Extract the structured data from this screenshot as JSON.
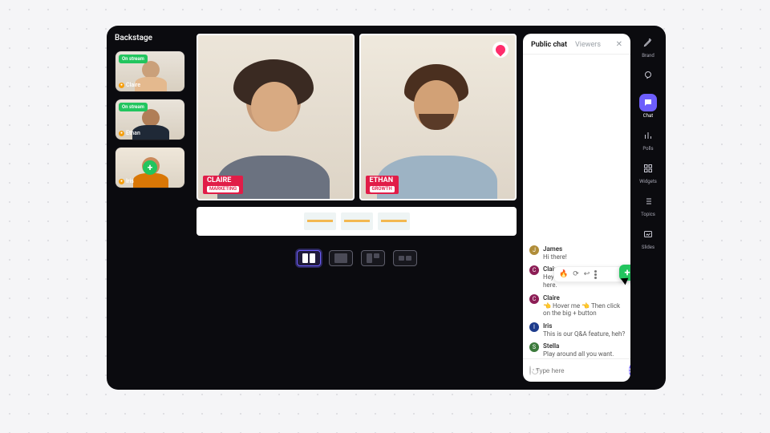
{
  "backstage": {
    "title": "Backstage",
    "participants": [
      {
        "name": "Claire",
        "on_stream": true
      },
      {
        "name": "Ethan",
        "on_stream": true
      },
      {
        "name": "Iris",
        "on_stream": false
      }
    ],
    "on_stream_label": "On stream"
  },
  "stage": {
    "tiles": [
      {
        "name": "CLAIRE",
        "subtitle": "MARKETING"
      },
      {
        "name": "ETHAN",
        "subtitle": "GROWTH"
      }
    ],
    "layouts": [
      "split-2",
      "pip",
      "grid-3",
      "grid-4"
    ],
    "active_layout": 0
  },
  "chat": {
    "tabs": [
      "Public chat",
      "Viewers"
    ],
    "active_tab": 0,
    "messages": [
      {
        "initial": "J",
        "color": "#b08d39",
        "author": "James",
        "text": "Hi there!"
      },
      {
        "initial": "C",
        "color": "#8c1d55",
        "author": "Claire",
        "text": "Hey! We love to see you here."
      },
      {
        "initial": "C",
        "color": "#8c1d55",
        "author": "Claire",
        "text": "👈 Hover me 👈\nThen click on the big + button"
      },
      {
        "initial": "I",
        "color": "#1d3b8c",
        "author": "Iris",
        "text": "This is our Q&A feature, heh?"
      },
      {
        "initial": "S",
        "color": "#3b7a3b",
        "author": "Stella",
        "text": "Play around all you want."
      }
    ],
    "input_placeholder": "Type here",
    "fab_label": "+"
  },
  "rail": [
    {
      "label": "Brand",
      "icon": "edit-icon"
    },
    {
      "label": "",
      "icon": "bubble-icon"
    },
    {
      "label": "Chat",
      "icon": "chat-icon",
      "active": true
    },
    {
      "label": "Polls",
      "icon": "bars-icon"
    },
    {
      "label": "Widgets",
      "icon": "grid-icon"
    },
    {
      "label": "Topics",
      "icon": "list-icon"
    },
    {
      "label": "Slides",
      "icon": "image-icon"
    }
  ],
  "colors": {
    "accent": "#6d5efc",
    "green": "#22c55e",
    "brand": "#ff2d6b"
  }
}
